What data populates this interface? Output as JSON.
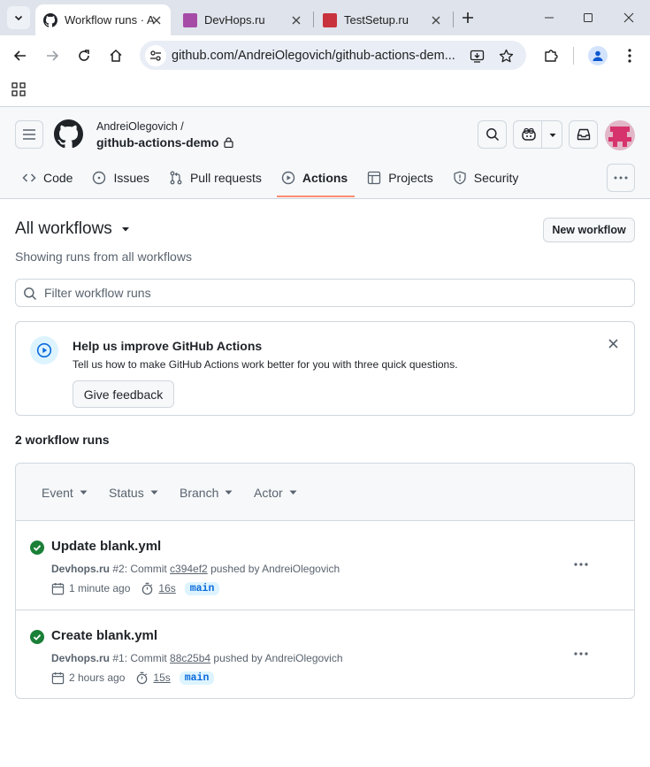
{
  "browser": {
    "tabs": [
      {
        "title": "Workflow runs · A",
        "favicon_color": "#1f2328"
      },
      {
        "title": "DevHops.ru",
        "favicon_color": "#a64ca6"
      },
      {
        "title": "TestSetup.ru",
        "favicon_color": "#c8323c"
      }
    ],
    "url": "github.com/AndreiOlegovich/github-actions-dem..."
  },
  "repo": {
    "owner": "AndreiOlegovich /",
    "name": "github-actions-demo"
  },
  "nav": {
    "code": "Code",
    "issues": "Issues",
    "pull_requests": "Pull requests",
    "actions": "Actions",
    "projects": "Projects",
    "security": "Security"
  },
  "main": {
    "title": "All workflows",
    "subtitle": "Showing runs from all workflows",
    "new_workflow": "New workflow",
    "filter_placeholder": "Filter workflow runs"
  },
  "banner": {
    "title": "Help us improve GitHub Actions",
    "description": "Tell us how to make GitHub Actions work better for you with three quick questions.",
    "button": "Give feedback"
  },
  "runs": {
    "count_label": "2 workflow runs",
    "filters": {
      "event": "Event",
      "status": "Status",
      "branch": "Branch",
      "actor": "Actor"
    },
    "items": [
      {
        "title": "Update blank.yml",
        "workflow": "Devhops.ru",
        "run_label": " #2: Commit ",
        "commit": "c394ef2",
        "pushed_by": " pushed by AndreiOlegovich",
        "time": "1 minute ago",
        "duration": "16s",
        "branch": "main",
        "status": "success"
      },
      {
        "title": "Create blank.yml",
        "workflow": "Devhops.ru",
        "run_label": " #1: Commit ",
        "commit": "88c25b4",
        "pushed_by": " pushed by AndreiOlegovich",
        "time": "2 hours ago",
        "duration": "15s",
        "branch": "main",
        "status": "success"
      }
    ]
  },
  "colors": {
    "success": "#1a7f37",
    "accent_underline": "#fd8c73",
    "link_blue": "#0969da"
  }
}
